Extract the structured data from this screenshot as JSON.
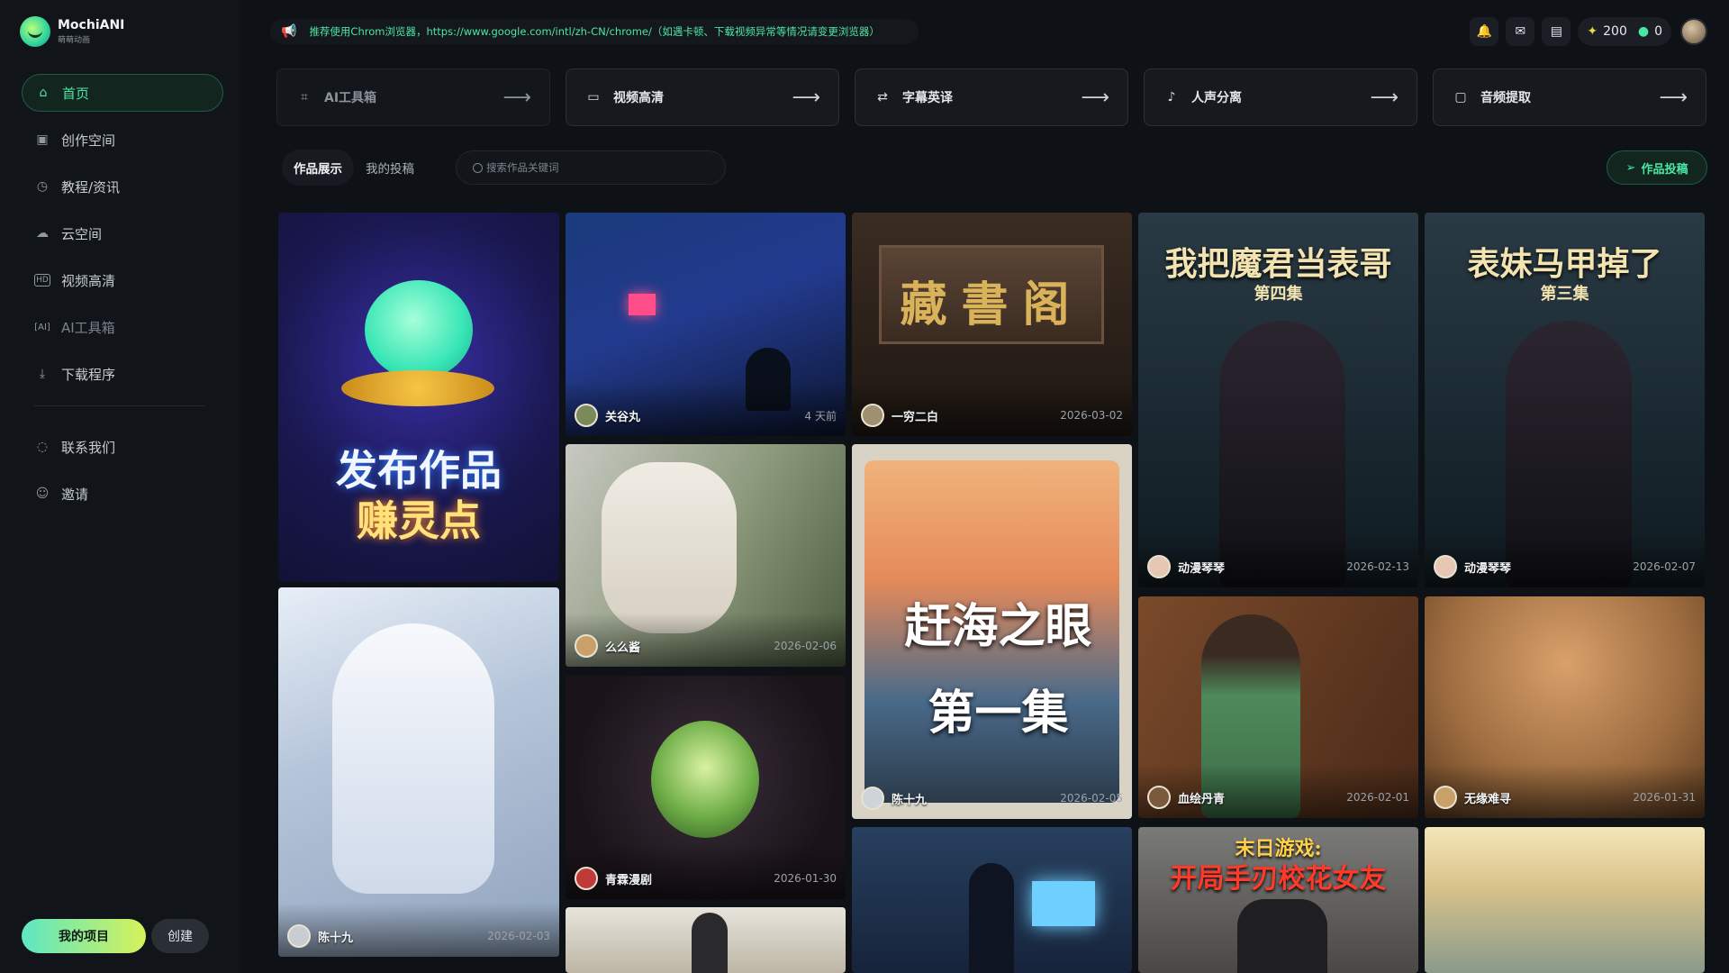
{
  "app": {
    "logo_title": "MochiANI",
    "logo_sub": "萌萌动画"
  },
  "sidebar": {
    "items": [
      {
        "label": "首页",
        "icon": "home-icon"
      },
      {
        "label": "创作空间",
        "icon": "film-icon"
      },
      {
        "label": "教程/资讯",
        "icon": "compass-icon"
      },
      {
        "label": "云空间",
        "icon": "cloud-icon"
      },
      {
        "label": "视频高清",
        "icon": "hd-icon"
      },
      {
        "label": "AI工具箱",
        "icon": "ai-box-icon"
      },
      {
        "label": "下载程序",
        "icon": "download-icon"
      }
    ],
    "items2": [
      {
        "label": "联系我们",
        "icon": "chat-icon"
      },
      {
        "label": "邀请",
        "icon": "invite-icon"
      }
    ],
    "my_projects": "我的项目",
    "create": "创建"
  },
  "notice": {
    "text": "推荐使用Chrom浏览器，https://www.google.com/intl/zh-CN/chrome/（如遇卡顿、下载视频异常等情况请变更浏览器）"
  },
  "topbar": {
    "points": "200",
    "cloud": "0"
  },
  "tools": [
    {
      "label": "AI工具箱",
      "icon": "ai-scan-icon"
    },
    {
      "label": "视频高清",
      "icon": "monitor-icon"
    },
    {
      "label": "字幕英译",
      "icon": "swap-icon"
    },
    {
      "label": "人声分离",
      "icon": "voice-icon"
    },
    {
      "label": "音频提取",
      "icon": "audio-file-icon"
    }
  ],
  "tabs": [
    "作品展示",
    "我的投稿"
  ],
  "search": {
    "placeholder": "搜索作品关键词"
  },
  "submit_label": "作品投稿",
  "cards": [
    {
      "title_lines": [
        "发布作品",
        "赚灵点"
      ],
      "user": "",
      "date": ""
    },
    {
      "user": "关谷丸",
      "date": "4 天前"
    },
    {
      "sign": "藏書阁",
      "user": "一穷二白",
      "date": "2026-03-02"
    },
    {
      "title": "我把魔君当表哥",
      "episode": "第四集",
      "user": "动漫琴琴",
      "date": "2026-02-13"
    },
    {
      "title": "表妹马甲掉了",
      "episode": "第三集",
      "user": "动漫琴琴",
      "date": "2026-02-07"
    },
    {
      "user": "么么酱",
      "date": "2026-02-06"
    },
    {
      "title": "赶海之眼",
      "episode": "第一集",
      "user": "陈十九",
      "date": "2026-02-05"
    },
    {
      "user": "血绘丹青",
      "date": "2026-02-01"
    },
    {
      "user": "无缘难寻",
      "date": "2026-01-31"
    },
    {
      "user": "陈十九",
      "date": "2026-02-03"
    },
    {
      "user": "青霖漫剧",
      "date": "2026-01-30"
    },
    {
      "title": "末日游戏:",
      "subtitle": "开局手刃校花女友",
      "user": "",
      "date": ""
    }
  ]
}
